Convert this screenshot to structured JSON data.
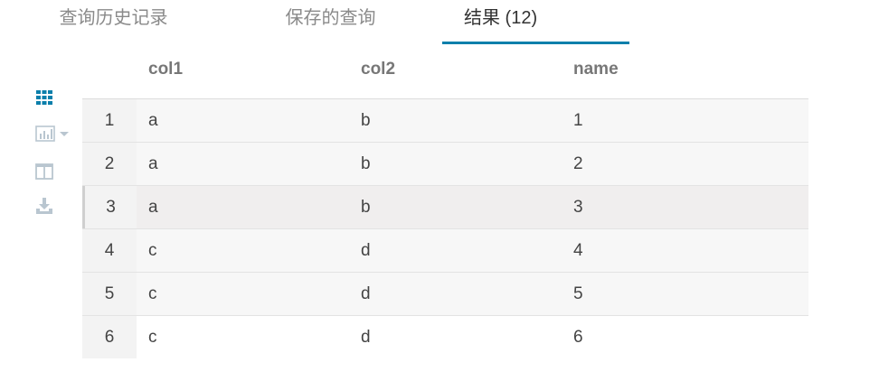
{
  "tabs": [
    {
      "label": "查询历史记录",
      "active": false
    },
    {
      "label": "保存的查询",
      "active": false
    },
    {
      "label": "结果 (12)",
      "active": true
    }
  ],
  "toolbar": {
    "icons": [
      "grid-icon",
      "bar-chart-icon",
      "chevron-down-icon",
      "columns-icon",
      "download-icon"
    ]
  },
  "table": {
    "columns": [
      "col1",
      "col2",
      "name"
    ],
    "rows": [
      {
        "num": "1",
        "col1": "a",
        "col2": "b",
        "name": "1"
      },
      {
        "num": "2",
        "col1": "a",
        "col2": "b",
        "name": "2"
      },
      {
        "num": "3",
        "col1": "a",
        "col2": "b",
        "name": "3"
      },
      {
        "num": "4",
        "col1": "c",
        "col2": "d",
        "name": "4"
      },
      {
        "num": "5",
        "col1": "c",
        "col2": "d",
        "name": "5"
      },
      {
        "num": "6",
        "col1": "c",
        "col2": "d",
        "name": "6"
      }
    ]
  },
  "colors": {
    "accent": "#0b7fab",
    "icon_muted": "#b9c6d0",
    "row_bg": "#f7f7f7",
    "row_hover_bg": "#f0eeee"
  }
}
